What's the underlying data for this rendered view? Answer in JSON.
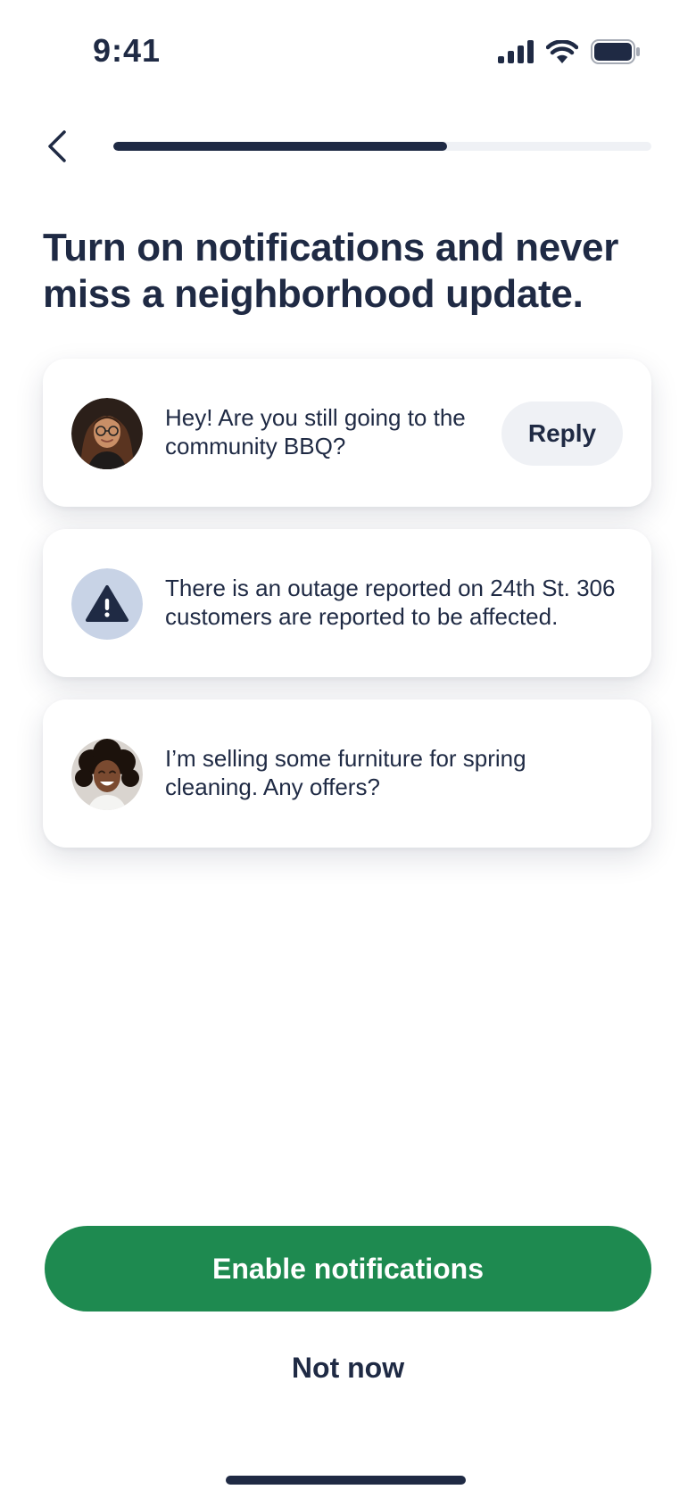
{
  "status_bar": {
    "time": "9:41"
  },
  "progress": {
    "fraction": 0.62
  },
  "headline": "Turn on notifications and never miss a neighborhood update.",
  "notifications": [
    {
      "avatar_icon": "woman-with-glasses-avatar",
      "text": "Hey! Are you still going to the community BBQ?",
      "action_label": "Reply"
    },
    {
      "avatar_icon": "warning-triangle-icon",
      "text": "There is an outage reported on 24th St. 306 customers are reported to be affected."
    },
    {
      "avatar_icon": "smiling-woman-avatar",
      "text": "I’m selling some furniture for spring cleaning. Any offers?"
    }
  ],
  "actions": {
    "primary_label": "Enable notifications",
    "secondary_label": "Not now"
  },
  "colors": {
    "text": "#1f2a44",
    "accent": "#1e8a50",
    "alert_circle": "#c8d3e6",
    "button_bg": "#eff1f5"
  }
}
